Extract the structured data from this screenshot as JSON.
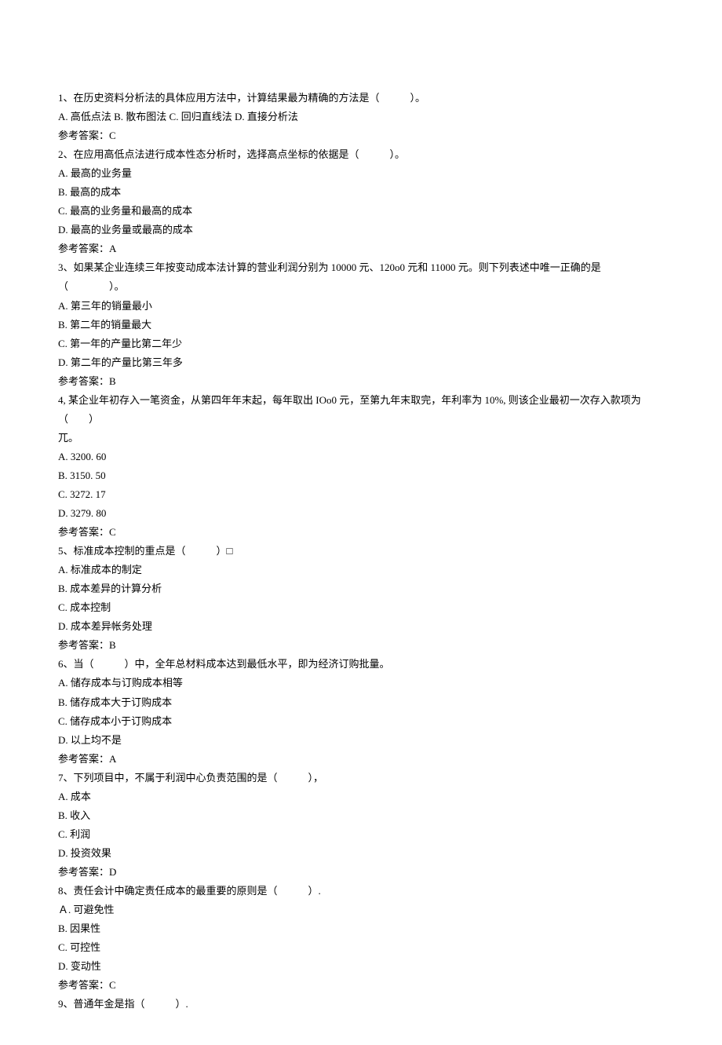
{
  "questions": [
    {
      "num": "1",
      "stem_lines": [
        "1、在历史资料分析法的具体应用方法中，计算结果最为精确的方法是（　　　）。"
      ],
      "option_lines": [
        "A. 高低点法 B. 散布图法 C. 回归直线法 D. 直接分析法"
      ],
      "answer": "参考答案：C"
    },
    {
      "num": "2",
      "stem_lines": [
        "2、在应用高低点法进行成本性态分析时，选择高点坐标的依据是（　　　）。"
      ],
      "option_lines": [
        "A. 最高的业务量",
        "B. 最高的成本",
        "C. 最高的业务量和最高的成本",
        "D. 最高的业务量或最高的成本"
      ],
      "answer": "参考答案：A"
    },
    {
      "num": "3",
      "stem_lines": [
        "3、如果某企业连续三年按变动成本法计算的营业利润分别为 10000 元、120o0 元和 11000 元。则下列表述中唯一正确的是（　　　　）。"
      ],
      "option_lines": [
        "A. 第三年的销量最小",
        "B. 第二年的销量最大",
        "C. 第一年的产量比第二年少",
        "D. 第二年的产量比第三年多"
      ],
      "answer": "参考答案：B"
    },
    {
      "num": "4",
      "stem_lines": [
        "4, 某企业年初存入一笔资金，从第四年年末起，每年取出 IOo0 元，至第九年末取完，年利率为 10%, 则该企业最初一次存入款项为（　　）",
        "兀。"
      ],
      "option_lines": [
        "A. 3200. 60",
        "B. 3150. 50",
        "C. 3272. 17",
        "D. 3279. 80"
      ],
      "answer": "参考答案：C"
    },
    {
      "num": "5",
      "stem_lines": [
        "5、标准成本控制的重点是（　　　）□"
      ],
      "option_lines": [
        "A. 标准成本的制定",
        "B. 成本差异的计算分析",
        "C. 成本控制",
        "D. 成本差异帐务处理"
      ],
      "answer": "参考答案：B"
    },
    {
      "num": "6",
      "stem_lines": [
        "6、当（　　　）中，全年总材料成本达到最低水平，即为经济订购批量。"
      ],
      "option_lines": [
        "A. 储存成本与订购成本相等",
        "B. 储存成本大于订购成本",
        "C. 储存成本小于订购成本",
        "D. 以上均不是"
      ],
      "answer": "参考答案：A"
    },
    {
      "num": "7",
      "stem_lines": [
        "7、下列项目中，不属于利润中心负责范围的是（　　　），"
      ],
      "option_lines": [
        "A. 成本",
        "B. 收入",
        "C. 利润",
        "D. 投资效果"
      ],
      "answer": "参考答案：D"
    },
    {
      "num": "8",
      "stem_lines": [
        "8、责任会计中确定责任成本的最重要的原则是（　　　）."
      ],
      "option_lines": [
        "Ａ. 可避免性",
        "B. 因果性",
        "C. 可控性",
        "D. 变动性"
      ],
      "answer": "参考答案：C"
    },
    {
      "num": "9",
      "stem_lines": [
        "9、普通年金是指（　　　）."
      ],
      "option_lines": [],
      "answer": ""
    }
  ]
}
